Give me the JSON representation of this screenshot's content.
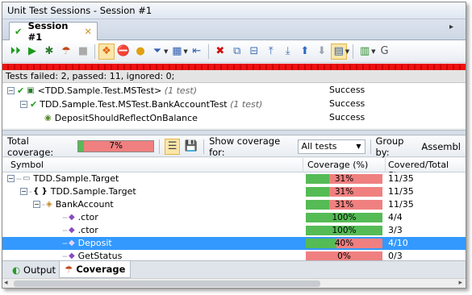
{
  "window": {
    "title": "Unit Test Sessions - Session #1"
  },
  "tab": {
    "label": "Session #1"
  },
  "toolbar_icons": [
    "run-all-icon",
    "run-icon",
    "debug-icon",
    "coverage-icon",
    "stop-icon",
    "color-icon",
    "abort-icon",
    "circle-icon",
    "filter-icon",
    "group-icon",
    "export-icon",
    "delete-icon",
    "copy-icon",
    "save-icon",
    "collapse-icon",
    "expand-icon",
    "up-icon",
    "down-icon",
    "layout-icon",
    "results-icon",
    "more-icon"
  ],
  "status": {
    "text": "Tests failed: 2, passed: 11, ignored: 0;"
  },
  "tests": [
    {
      "name": "<TDD.Sample.Test.MSTest>",
      "count": "(1 test)",
      "result": "Success"
    },
    {
      "name": "TDD.Sample.Test.MSTest.BankAccountTest",
      "count": "(1 test)",
      "result": "Success"
    },
    {
      "name": "DepositShouldReflectOnBalance",
      "count": "",
      "result": "Success"
    }
  ],
  "coverage_bar": {
    "total_label": "Total coverage:",
    "total_value": "7%",
    "total_fraction": 0.07,
    "show_for_label": "Show coverage for:",
    "show_for_value": "All tests",
    "group_by_label": "Group by:",
    "group_by_value": "Assembl"
  },
  "columns": {
    "symbol": "Symbol",
    "coverage": "Coverage (%)",
    "stmts": "Covered/Total Stm"
  },
  "coverage_rows": [
    {
      "name": "TDD.Sample.Target",
      "pct": "31%",
      "fraction": 0.31,
      "stmts": "11/35"
    },
    {
      "name": "TDD.Sample.Target",
      "pct": "31%",
      "fraction": 0.31,
      "stmts": "11/35"
    },
    {
      "name": "BankAccount",
      "pct": "31%",
      "fraction": 0.31,
      "stmts": "11/35"
    },
    {
      "name": ".ctor",
      "pct": "100%",
      "fraction": 1.0,
      "stmts": "4/4"
    },
    {
      "name": ".ctor",
      "pct": "100%",
      "fraction": 1.0,
      "stmts": "3/3"
    },
    {
      "name": "Deposit",
      "pct": "40%",
      "fraction": 0.4,
      "stmts": "4/10"
    },
    {
      "name": "GetStatus",
      "pct": "0%",
      "fraction": 0.0,
      "stmts": "0/3"
    }
  ],
  "bottom_tabs": {
    "output": "Output",
    "coverage": "Coverage"
  },
  "colors": {
    "covered": "#55bb55",
    "uncovered": "#f08080",
    "selection": "#3399ff",
    "failed": "#dd1111"
  }
}
